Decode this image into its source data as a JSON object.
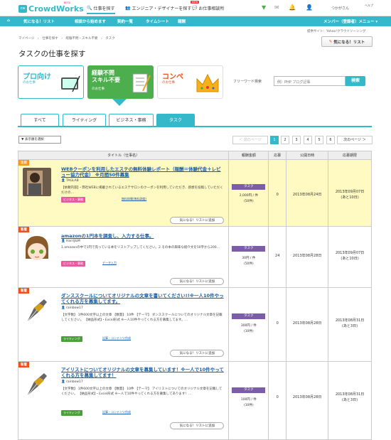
{
  "header": {
    "logo_mark": "cw",
    "logo_text": "CrowdWorks",
    "logo_badge": "BETA",
    "nav": [
      {
        "label": "仕事を探す",
        "icon": "search-icon"
      },
      {
        "label": "エンジニア・デザイナーを探す",
        "icon": "people-icon"
      },
      {
        "label": "お仕事相談所",
        "icon": "chat-icon",
        "badge": "NEW"
      }
    ],
    "user_name": "つかがさん",
    "user_sub": "ヘルプ"
  },
  "subnav": {
    "items": [
      "気になる！リスト",
      "相談から始めます",
      "契約一覧",
      "タイムシート",
      "報酬"
    ],
    "right": "メンバー（登録者）メニュー ▾"
  },
  "breadcrumb": "マイページ　›　仕事を探す　›　経験不問・スキル不要　›　タスク",
  "partner": "提供サイト：Yahoo!クラウドソーシング",
  "fav_top": "気になる！リスト",
  "page_title": "タスクの仕事を探す",
  "categories": [
    {
      "title": "プロ向け",
      "sub": "のお仕事"
    },
    {
      "title": "経験不問\nスキル不要",
      "sub": "のお仕事"
    },
    {
      "title": "コンペ",
      "sub": "のお仕事"
    }
  ],
  "search": {
    "label": "フリーワード検索",
    "placeholder": "例）PHP ブログ記事",
    "button": "検索"
  },
  "tabs": [
    "すべて",
    "ライティング",
    "ビジネス・事務",
    "タスク"
  ],
  "sort_label": "▼ 表示順を選択",
  "pager": {
    "prev": "＜ 前のページ",
    "pages": [
      "1",
      "2",
      "3",
      "4",
      "5",
      "6"
    ],
    "next": "次のページ ＞"
  },
  "table": {
    "headers": [
      "タイトル（仕事名）",
      "報酬金額",
      "応募",
      "公開日時",
      "応募期限"
    ],
    "rows": [
      {
        "badge": "注目",
        "title": "WEBクーポンを利用したエステの無料体験レポート（報酬＝体験代金＋レビュー協力代金） ※月間50件募集",
        "owner": "TAGLAB",
        "desc": "【依頼内容】・弊社WEBに掲載されているエステサロンのクーポンを利用していただき、感想を投稿していただくだけの…",
        "tag": "ビジネス・事務",
        "tag_link": "無料体験(無料調査)",
        "kind": "タスク",
        "amount": "2,000円 / 件",
        "count": "(50件)",
        "applicants": "0",
        "published": "2013年08月24日",
        "deadline": "2013年09月07日",
        "remain": "(あと10日)",
        "fav": "気になる！リストに追加"
      },
      {
        "badge": "新着",
        "title": "amazonの1円本を調査し、入力する仕事。",
        "owner": "HarriJ&M",
        "desc": "1.amazonの中で1円で売っている本をリストアップしてください。2.その本の興味な紹介文を50字から200…",
        "tag": "ビジネス・事務",
        "tag_link": "データ入力",
        "kind": "タスク",
        "amount": "30円 / 件",
        "count": "(50件)",
        "applicants": "24",
        "published": "2013年08月28日",
        "deadline": "2013年09月07日",
        "remain": "(あと10日)",
        "fav": "気になる！リストに追加"
      },
      {
        "badge": "新着",
        "title": "ダンススクールについてオリジナルの文章を書いてください!!※一人10件やってくれる方を募集してます。",
        "owner": "rainbow17",
        "desc": "【文字数】 1件600文字以上の文章 【数量】 10件 【テーマ】 ダンススクールについてのオリジナル文章を記載してください。 【納品形式】・Excel形式 ※一人10件やってくれる方を募集してます。…",
        "tag": "ライティング",
        "tag_link": "記事・コンテンツ作成",
        "kind": "タスク",
        "amount": "300円 / 件",
        "count": "(10件)",
        "applicants": "0",
        "published": "2013年08月28日",
        "deadline": "2013年08月31日",
        "remain": "(あと3日)",
        "fav": "気になる！リストに追加"
      },
      {
        "badge": "新着",
        "title": "アイリストについてオリジナルの文章を募集しています！※一人で10件やってくれる方を募集してます！",
        "owner": "rainbow17",
        "desc": "【文字数】 1件600文字以上の文章 【数量】 10件 【テーマ】 アイリストについてのオリジナル文章を記載してください。 【納品形式】・Excel形式 ※一人で10件やってくれる方を募集してあります！…",
        "tag": "ライティング",
        "tag_link": "記事・コンテンツ作成",
        "kind": "タスク",
        "amount": "100円 / 件",
        "count": "(10件)",
        "applicants": "0",
        "published": "2013年08月28日",
        "deadline": "2013年08月31日",
        "remain": "(あと3日)",
        "fav": "気になる！リストに追加"
      }
    ]
  },
  "colors": {
    "brand": "#33b9c9",
    "kind": "#7b5ea7",
    "biz": "#e85aa0",
    "writing": "#4c9e3c",
    "badge_hot": "#f39a1a",
    "badge_new": "#e8531f",
    "highlight": "#fff9c2"
  }
}
